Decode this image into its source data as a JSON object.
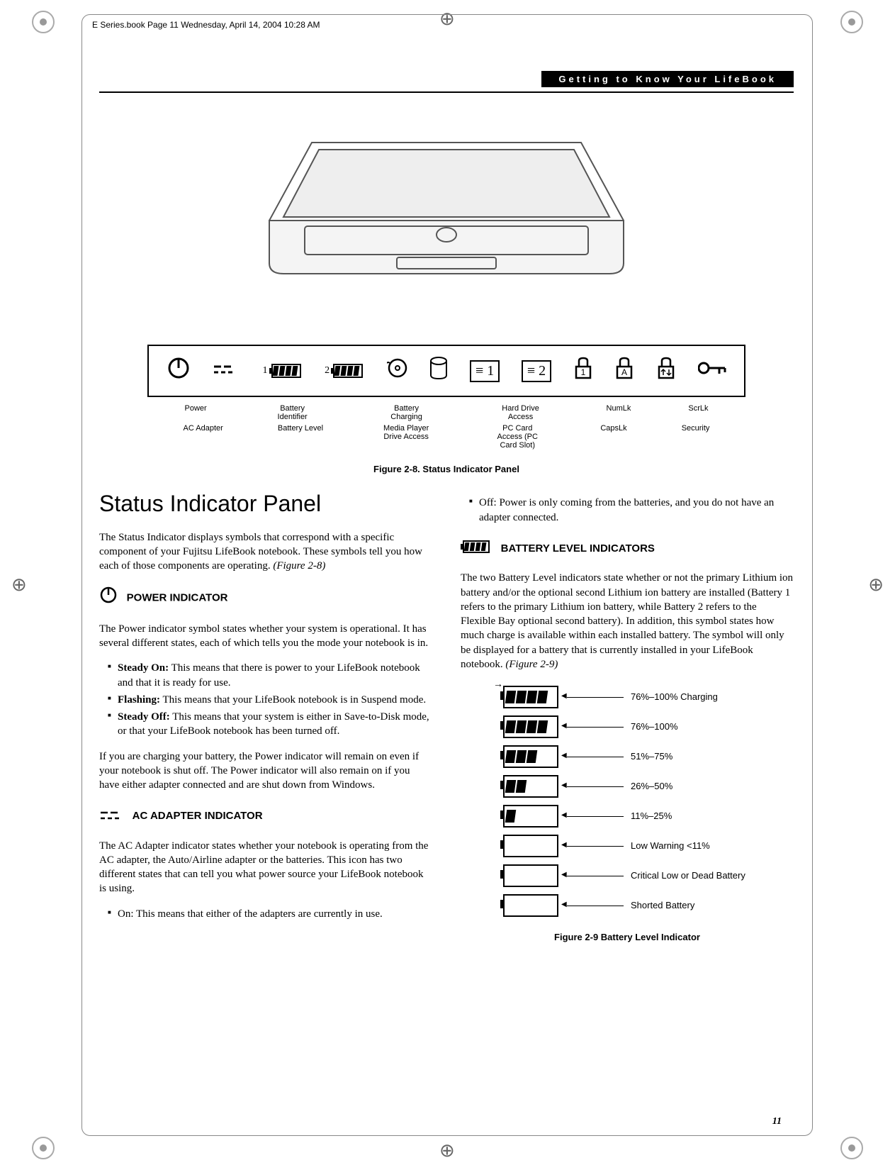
{
  "meta": {
    "book_line": "E Series.book  Page 11  Wednesday, April 14, 2004  10:28 AM",
    "header_title": "Getting to Know Your LifeBook",
    "page_number": "11"
  },
  "figure28": {
    "caption": "Figure 2-8. Status Indicator Panel",
    "labels_row1": [
      "Power",
      "Battery Identifier",
      "Battery Charging",
      "Hard Drive Access",
      "NumLk",
      "ScrLk"
    ],
    "labels_row2": [
      "AC Adapter",
      "Battery Level",
      "Media Player Drive Access",
      "PC Card Access (PC Card Slot)",
      "CapsLk",
      "Security"
    ]
  },
  "left": {
    "h1": "Status Indicator Panel",
    "intro": "The Status Indicator displays symbols that correspond with a specific component of your Fujitsu LifeBook notebook. These symbols tell you how each of those components are operating. ",
    "intro_ref": "(Figure 2-8)",
    "power_head": "POWER INDICATOR",
    "power_body": "The Power indicator symbol states whether your system is operational. It has several different states, each of which tells you the mode your notebook is in.",
    "power_list": [
      {
        "b": "Steady On:",
        "t": " This means that there is power to your LifeBook notebook and that it is ready for use."
      },
      {
        "b": "Flashing:",
        "t": " This means that your LifeBook notebook is in Suspend mode."
      },
      {
        "b": "Steady Off:",
        "t": " This means that your system is either in Save-to-Disk mode, or that your LifeBook notebook has been turned off."
      }
    ],
    "power_tail": "If you are charging your battery, the Power indicator will remain on even if your notebook is shut off. The Power indicator will also remain on if you have either adapter connected and are shut down from Windows.",
    "ac_head": "AC ADAPTER INDICATOR",
    "ac_body": "The AC Adapter indicator states whether your notebook is operating from the AC adapter, the Auto/Airline adapter or the batteries. This icon has two different states that can tell you what power source your LifeBook notebook is using.",
    "ac_list_on": "On: This means that either of the adapters are currently in use."
  },
  "right": {
    "off_item": "Off: Power is only coming from the batteries, and you do not have an adapter connected.",
    "batt_head": "BATTERY LEVEL INDICATORS",
    "batt_body": "The two Battery Level indicators state whether or not the primary Lithium ion battery and/or the optional second Lithium ion battery are installed (Battery 1 refers to the primary Lithium ion battery, while Battery 2 refers to the Flexible Bay optional second battery). In addition, this symbol states how much charge is available within each installed battery. The symbol will only be displayed for a battery that is currently installed in your LifeBook notebook. ",
    "batt_ref": "(Figure 2-9)",
    "figure29_caption": "Figure 2-9  Battery Level Indicator"
  },
  "chart_data": {
    "type": "table",
    "title": "Battery Level Indicator",
    "rows": [
      {
        "segments": 4,
        "charging": true,
        "label": "76%–100% Charging"
      },
      {
        "segments": 4,
        "charging": false,
        "label": "76%–100%"
      },
      {
        "segments": 3,
        "charging": false,
        "label": "51%–75%"
      },
      {
        "segments": 2,
        "charging": false,
        "label": "26%–50%"
      },
      {
        "segments": 1,
        "charging": false,
        "label": "11%–25%"
      },
      {
        "segments": 0,
        "charging": false,
        "label": "Low Warning <11%"
      },
      {
        "segments": 0,
        "charging": false,
        "label": "Critical Low or Dead Battery"
      },
      {
        "segments": 0,
        "charging": false,
        "label": "Shorted Battery"
      }
    ]
  }
}
